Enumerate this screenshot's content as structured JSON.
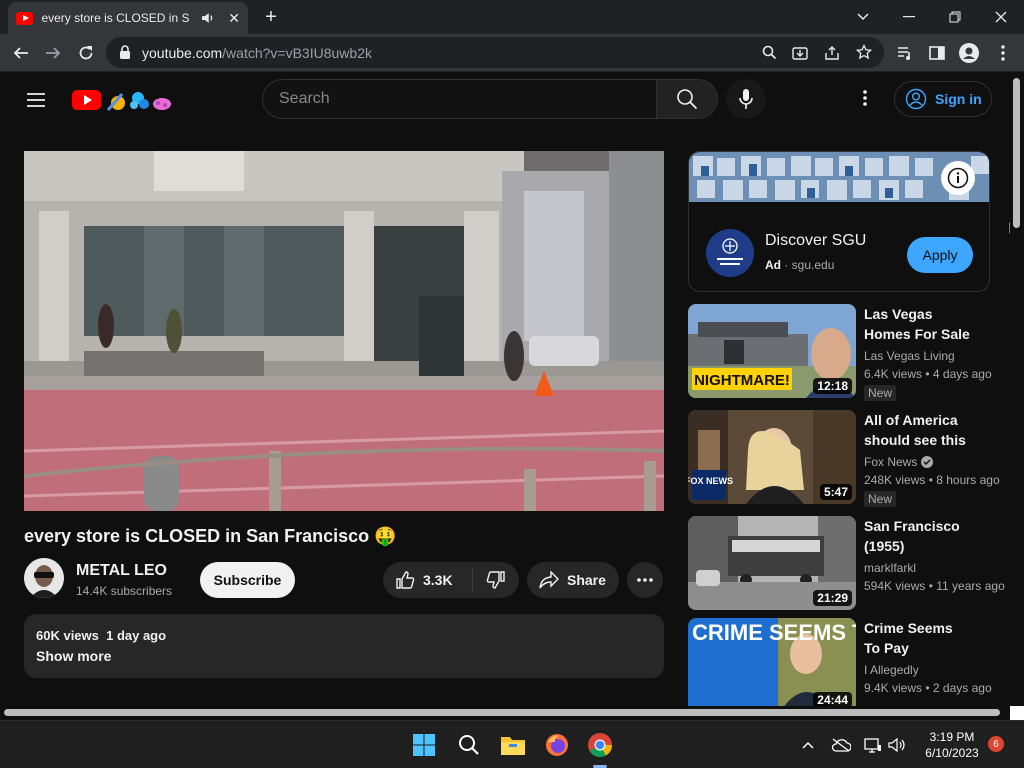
{
  "browser": {
    "tab_title": "every store is CLOSED in San Francisco 🤑 - YouTube",
    "url_host": "youtube.com",
    "url_path": "/watch?v=vB3IU8uwb2k",
    "new_tab_label": "+"
  },
  "header": {
    "search_placeholder": "Search",
    "signin_label": "Sign in"
  },
  "video": {
    "title": "every store is CLOSED in San Francisco 🤑",
    "channel": "METAL LEO",
    "subscribers": "14.4K subscribers",
    "subscribe_label": "Subscribe",
    "likes": "3.3K",
    "share_label": "Share",
    "meta": "60K views  1 day ago",
    "show_more": "Show more"
  },
  "ad": {
    "title": "Discover SGU",
    "badge": "Ad",
    "domain": "sgu.edu",
    "apply_label": "Apply"
  },
  "related": [
    {
      "title": "Las Vegas Homes For Sale",
      "channel": "Las Vegas Living",
      "verified": false,
      "views": "6.4K views",
      "age": "4 days ago",
      "badge": "New",
      "duration": "12:18",
      "thumb_text": "NIGHTMARE!"
    },
    {
      "title": "All of America should see this",
      "channel": "Fox News",
      "verified": true,
      "views": "248K views",
      "age": "8 hours ago",
      "badge": "New",
      "duration": "5:47",
      "thumb_text": "FOX NEWS"
    },
    {
      "title": "San Francisco (1955)",
      "channel": "marklfarkl",
      "verified": false,
      "views": "594K views",
      "age": "11 years ago",
      "badge": "",
      "duration": "21:29",
      "thumb_text": ""
    },
    {
      "title": "Crime Seems To Pay",
      "channel": "I Allegedly",
      "verified": false,
      "views": "9.4K views",
      "age": "2 days ago",
      "badge": "",
      "duration": "24:44",
      "thumb_text": "CRIME SEEMS TO PAY"
    }
  ],
  "taskbar": {
    "time": "3:19 PM",
    "date": "6/10/2023",
    "notifications": "6"
  },
  "colors": {
    "youtube_red": "#ff0000",
    "link_blue": "#3ea6ff",
    "page_bg": "#0f0f0f",
    "chip_bg": "#272727"
  }
}
